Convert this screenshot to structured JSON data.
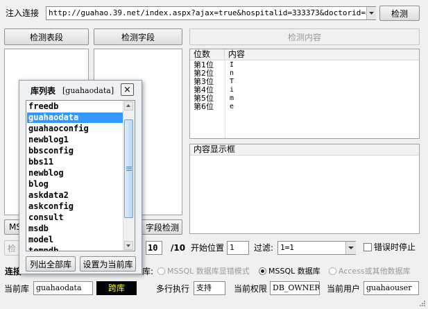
{
  "inject": {
    "label": "注入连接",
    "url": "http://guahao.39.net/index.aspx?ajax=true&hospitalid=333373&doctorid=341314",
    "detect_btn": "检测"
  },
  "top_buttons": {
    "detect_tables": "检测表段",
    "detect_fields": "检测字段",
    "detect_content": "检测内容"
  },
  "results_table": {
    "col_pos": "位数",
    "col_content": "内容",
    "rows": [
      {
        "pos": "第1位",
        "val": "I"
      },
      {
        "pos": "第2位",
        "val": "n"
      },
      {
        "pos": "第3位",
        "val": "T"
      },
      {
        "pos": "第4位",
        "val": "i"
      },
      {
        "pos": "第5位",
        "val": "m"
      },
      {
        "pos": "第6位",
        "val": "e"
      }
    ]
  },
  "content_box": {
    "header": "内容显示框"
  },
  "db_dialog": {
    "title": "库列表",
    "current": "[guahaodata]",
    "close": "×",
    "items": [
      "freedb",
      "guahaodata",
      "guahaoconfig",
      "newblog1",
      "bbsconfig",
      "bbs11",
      "newblog",
      "blog",
      "askdata2",
      "askconfig",
      "consult",
      "msdb",
      "model",
      "tempdb"
    ],
    "selected_index": 1,
    "list_all_btn": "列出全部库",
    "set_current_btn": "设置为当前库"
  },
  "colors": {
    "selection": "#3399ff",
    "accent_dark": "#000000",
    "accent_text": "#ffff00"
  },
  "behind_dialog": {
    "ms_prefix": "MS",
    "field_detect": "字段检测",
    "jian": "检",
    "lian": "连接",
    "ku": "库:"
  },
  "params": {
    "ten": "10",
    "slash": "/10",
    "start_label": "开始位置",
    "start_value": "1",
    "filter_label": "过滤:",
    "filter_value": "1=1",
    "stop_on_error": "错误时停止"
  },
  "db_types": {
    "mssql_error": "MSSQL 数据库显错模式",
    "mssql": "MSSQL 数据库",
    "access": "Access或其他数据库"
  },
  "status": {
    "cur_db_label": "当前库",
    "cur_db": "guahaodata",
    "cross_db": "跨库",
    "multi_exec_label": "多行执行",
    "multi_exec": "支持",
    "perm_label": "当前权限",
    "perm": "DB_OWNER",
    "user_label": "当前用户",
    "user": "guahaouser"
  }
}
